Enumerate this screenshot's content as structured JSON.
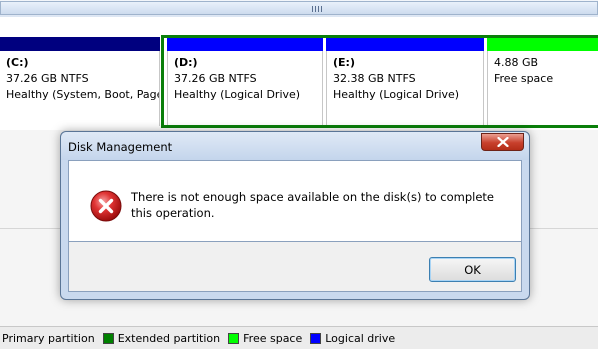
{
  "scrollbar": {
    "grip_icon": "scroll-grip-icon"
  },
  "partitions": [
    {
      "name": "(C:)",
      "size": "37.26 GB NTFS",
      "status": "Healthy (System, Boot, Page",
      "bar_color": "#00007f"
    },
    {
      "name": "(D:)",
      "size": "37.26 GB NTFS",
      "status": "Healthy (Logical Drive)",
      "bar_color": "#0000ff"
    },
    {
      "name": "(E:)",
      "size": "32.38 GB NTFS",
      "status": "Healthy (Logical Drive)",
      "bar_color": "#0000ff"
    },
    {
      "name": "",
      "size": "4.88 GB",
      "status": "Free space",
      "bar_color": "#00ff00"
    }
  ],
  "extended_partition_border_color": "#0a7f0a",
  "dialog": {
    "title": "Disk Management",
    "close_icon": "close-icon",
    "error_icon": "error-icon",
    "message": "There is not enough space available on the disk(s) to complete this operation.",
    "ok_label": "OK"
  },
  "legend": [
    {
      "label": "Primary partition",
      "color": "#00007f"
    },
    {
      "label": "Extended partition",
      "color": "#008000"
    },
    {
      "label": "Free space",
      "color": "#00ff00"
    },
    {
      "label": "Logical drive",
      "color": "#0000ff"
    }
  ]
}
